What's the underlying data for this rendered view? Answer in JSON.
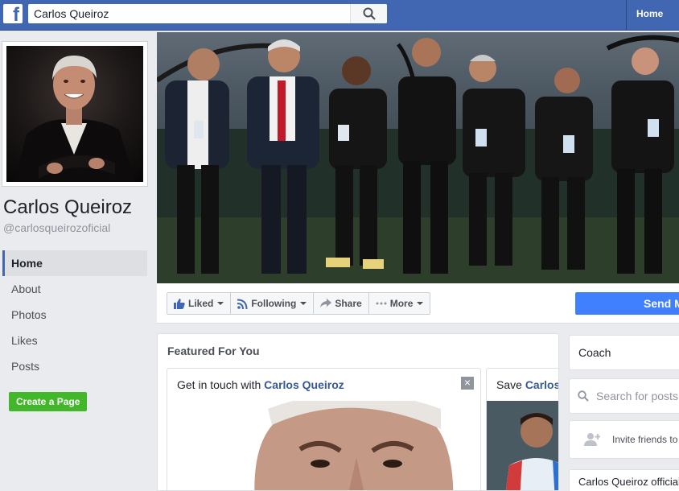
{
  "topbar": {
    "logo": "f",
    "search_value": "Carlos Queiroz",
    "search_icon": "search-icon",
    "nav_home": "Home",
    "brand_color": "#4267b2"
  },
  "page": {
    "name": "Carlos Queiroz",
    "handle": "@carlosqueirozoficial"
  },
  "sidebar": {
    "items": [
      {
        "label": "Home",
        "active": true
      },
      {
        "label": "About"
      },
      {
        "label": "Photos"
      },
      {
        "label": "Likes"
      },
      {
        "label": "Posts"
      }
    ],
    "create_page": "Create a Page"
  },
  "actions": {
    "liked": "Liked",
    "following": "Following",
    "share": "Share",
    "more": "More",
    "send": "Send M"
  },
  "featured": {
    "title": "Featured For You",
    "card1_prefix": "Get in touch with ",
    "card1_name": "Carlos Queiroz",
    "card2_prefix": "Save ",
    "card2_name": "Carlos",
    "close": "×"
  },
  "right": {
    "category": "Coach",
    "search_placeholder": "Search for posts",
    "invite": "Invite friends to",
    "official": "Carlos Queiroz official"
  },
  "colors": {
    "accent": "#4267b2",
    "send": "#4080ff",
    "create": "#42b72a"
  }
}
